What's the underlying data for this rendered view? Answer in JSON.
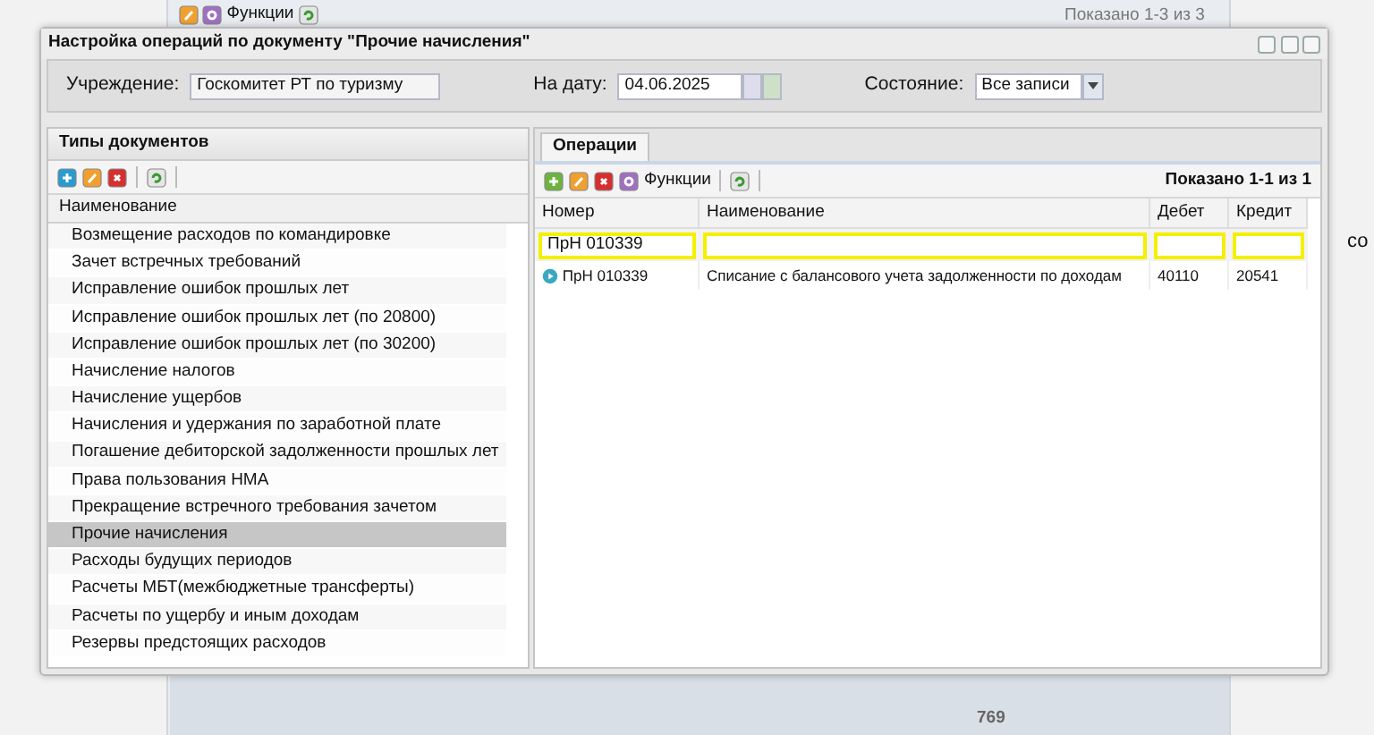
{
  "background_app": {
    "functions_label": "Функции",
    "pager": "Показано 1-3 из 3",
    "right_labels": [
      "со"
    ],
    "footer_value": "769"
  },
  "dialog": {
    "title": "Настройка операций по документу \"Прочие начисления\"",
    "filters": [
      {
        "kind": "text",
        "label": "Учреждение:",
        "value": "Госкомитет РТ по туризму"
      },
      {
        "kind": "date",
        "label": "На дату:",
        "value": "04.06.2025"
      },
      {
        "kind": "select",
        "label": "Состояние:",
        "value": "Все записи"
      }
    ],
    "left_panel": {
      "title": "Типы документов",
      "column": "Наименование",
      "items": [
        {
          "label": "Возмещение расходов по командировке",
          "selected": false
        },
        {
          "label": "Зачет встречных требований",
          "selected": false
        },
        {
          "label": "Исправление ошибок прошлых лет",
          "selected": false
        },
        {
          "label": "Исправление ошибок прошлых лет (по 20800)",
          "selected": false
        },
        {
          "label": "Исправление ошибок прошлых лет (по 30200)",
          "selected": false
        },
        {
          "label": "Начисление налогов",
          "selected": false
        },
        {
          "label": "Начисление ущербов",
          "selected": false
        },
        {
          "label": "Начисления и удержания по заработной плате",
          "selected": false
        },
        {
          "label": "Погашение дебиторской задолженности прошлых лет",
          "selected": false
        },
        {
          "label": "Права пользования НМА",
          "selected": false
        },
        {
          "label": "Прекращение встречного требования зачетом",
          "selected": false
        },
        {
          "label": "Прочие начисления",
          "selected": true
        },
        {
          "label": "Расходы будущих периодов",
          "selected": false
        },
        {
          "label": "Расчеты МБТ(межбюджетные трансферты)",
          "selected": false
        },
        {
          "label": "Расчеты по ущербу и иным доходам",
          "selected": false
        },
        {
          "label": "Резервы предстоящих расходов",
          "selected": false
        }
      ]
    },
    "right_panel": {
      "tabs": [
        {
          "label": "Операции",
          "selected": true
        }
      ],
      "functions_label": "Функции",
      "pager": "Показано 1-1 из 1",
      "columns": [
        "Номер",
        "Наименование",
        "Дебет",
        "Кредит"
      ],
      "number_filter": "ПрН 010339",
      "rows": [
        {
          "number": "ПрН 010339",
          "name": "Списание с балансового учета задолженности по доходам",
          "debit": "40110",
          "credit": "20541"
        }
      ]
    }
  }
}
